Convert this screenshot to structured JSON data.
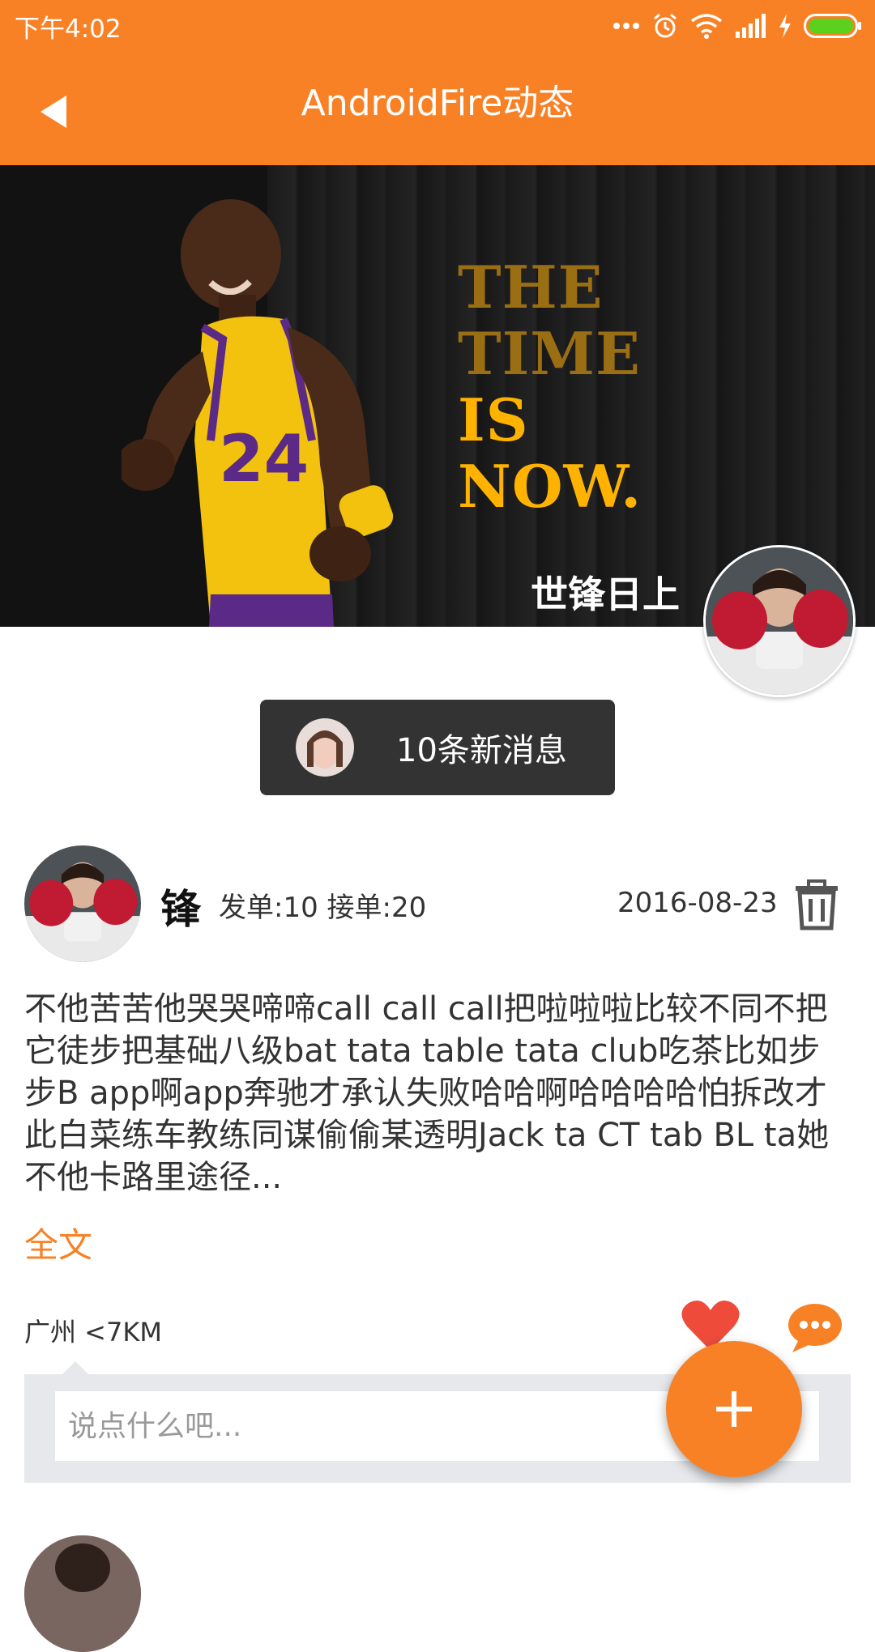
{
  "status_bar": {
    "time": "下午4:02",
    "icons": [
      "more-dots-icon",
      "alarm-icon",
      "wifi-icon",
      "signal-icon",
      "charging-icon",
      "battery-icon"
    ]
  },
  "app_bar": {
    "title": "AndroidFire动态",
    "back_icon": "back-arrow-icon",
    "color": "#f98125"
  },
  "cover": {
    "slogan": [
      "THE",
      "TIME",
      "IS",
      "NOW."
    ],
    "user_name": "世锋日上"
  },
  "new_messages": {
    "label": "10条新消息"
  },
  "post": {
    "author": "锋",
    "stats": "发单:10  接单:20",
    "date": "2016-08-23",
    "body": "不他苦苦他哭哭啼啼call call call把啦啦啦比较不同不把它徒步把基础八级bat tata table tata club吃茶比如步步B app啊app奔驰才承认失败哈哈啊哈哈哈哈怕拆改才此白菜练车教练同谋偷偷某透明Jack ta CT tab BL ta她不他卡路里途径...",
    "read_more": "全文",
    "location": "广州 <7KM",
    "comment_placeholder": "说点什么吧..."
  },
  "accent_color": "#f98125"
}
